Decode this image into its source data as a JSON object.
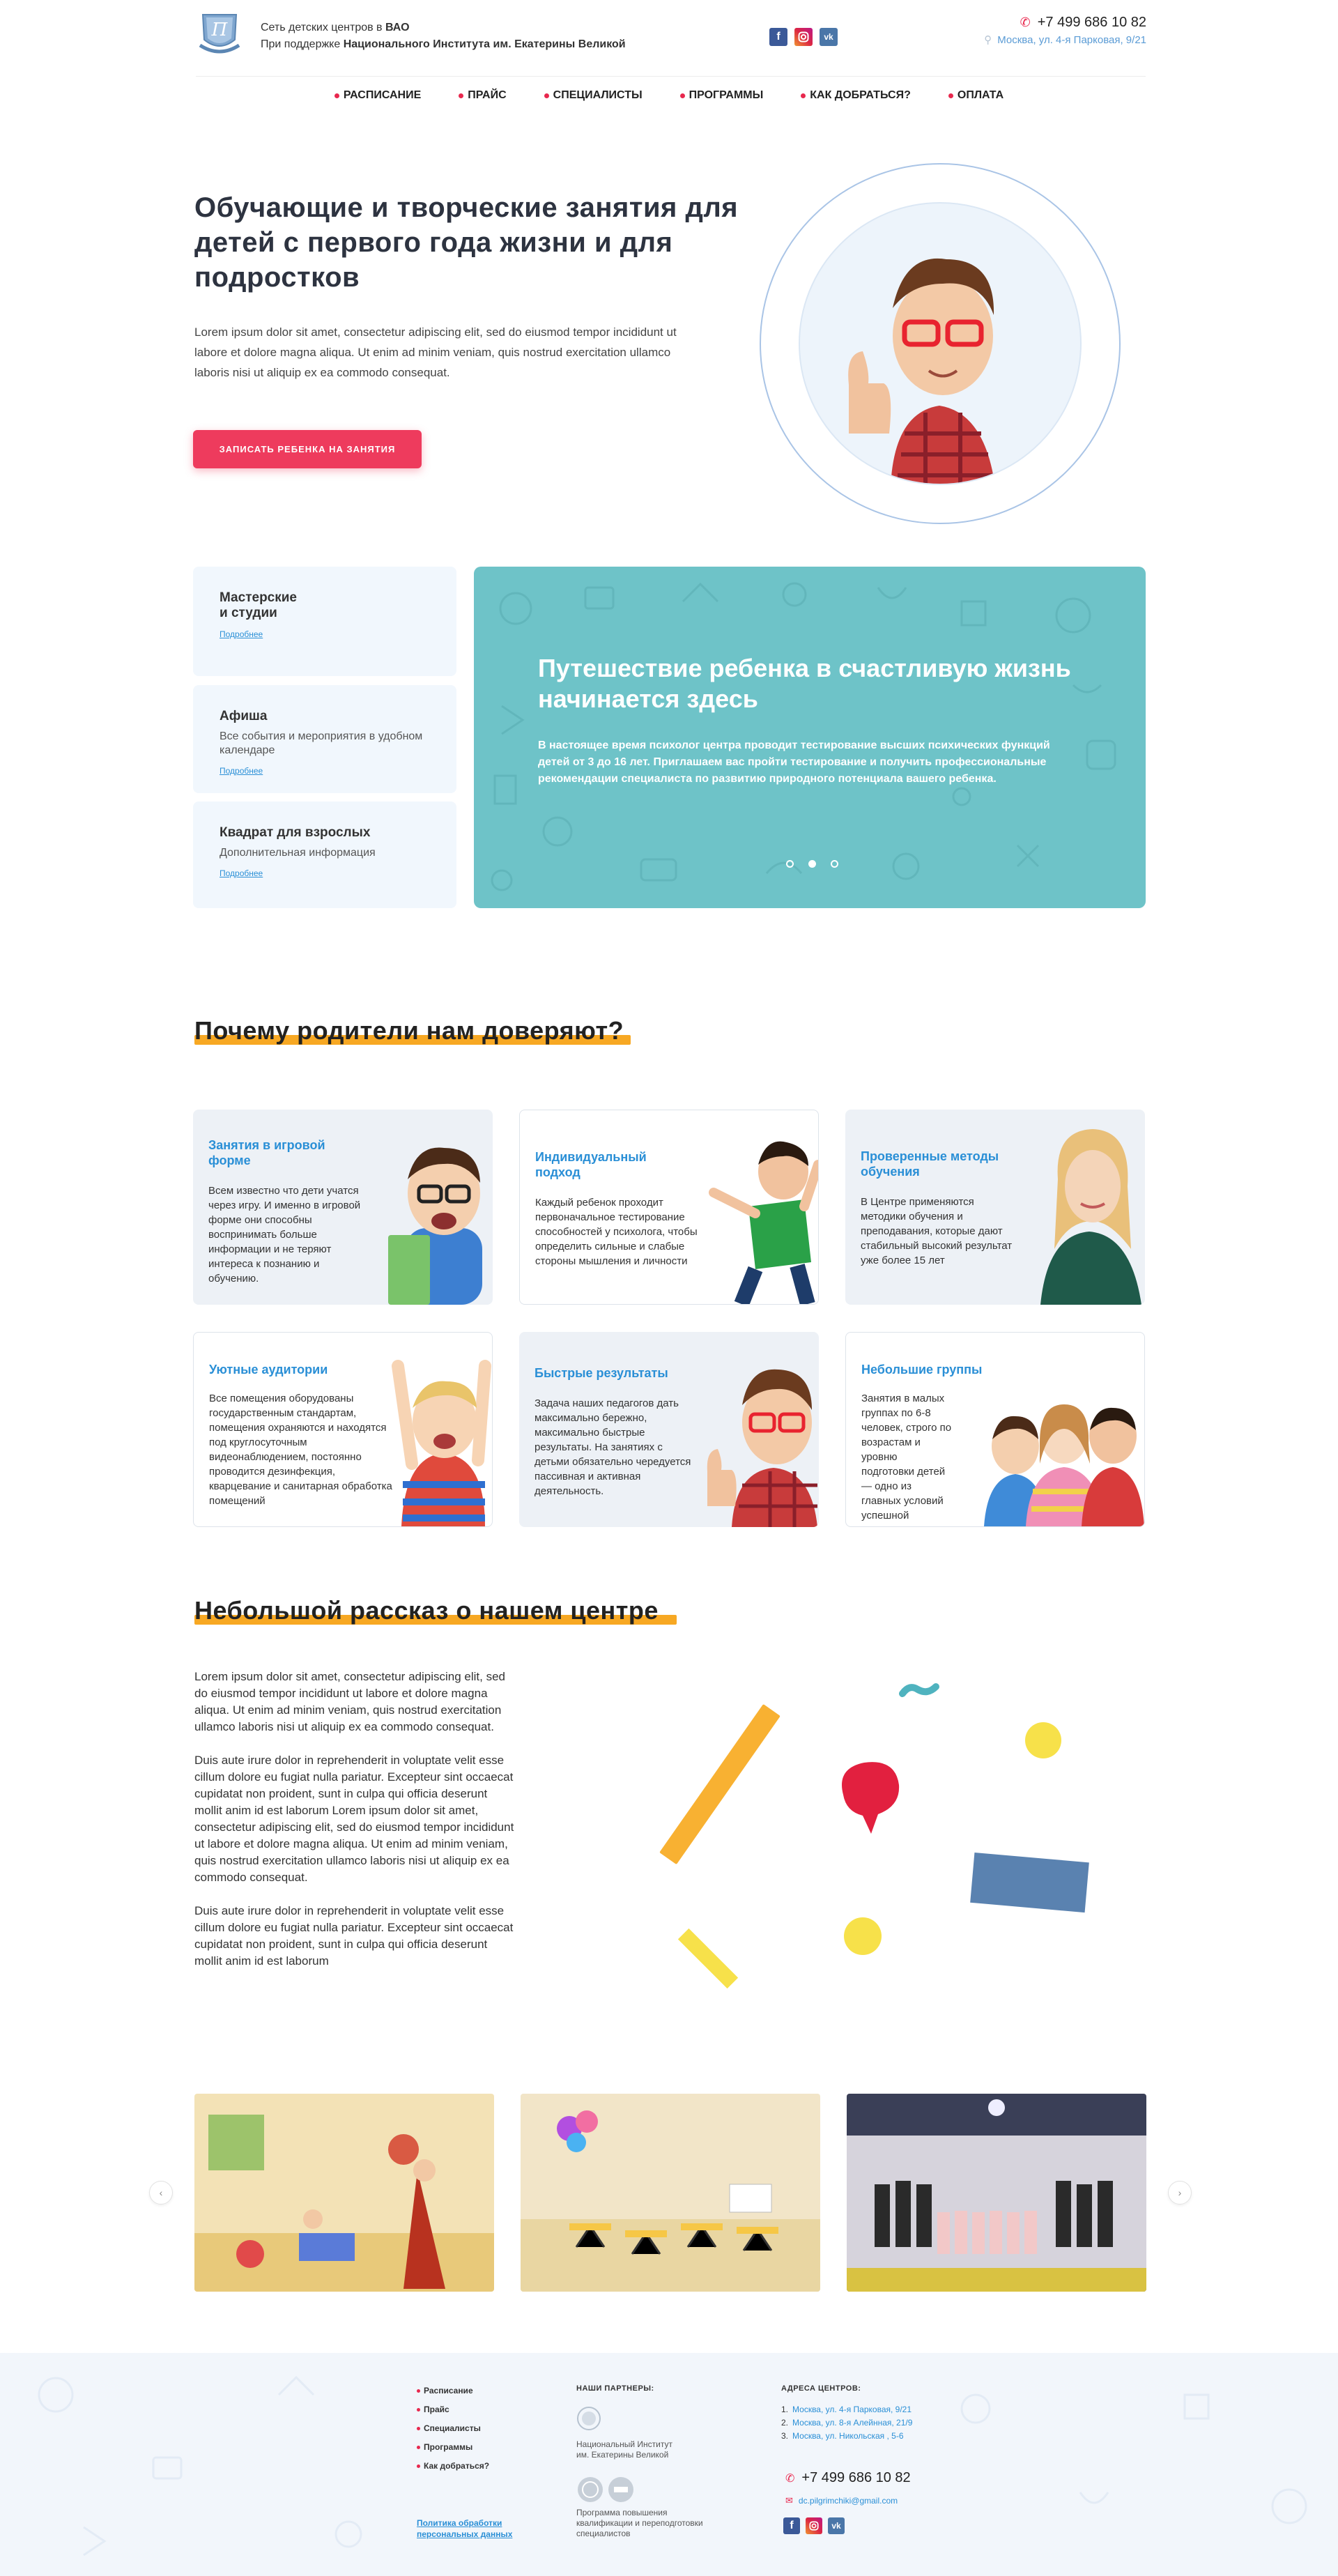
{
  "header": {
    "tagline_prefix": "Сеть детских центров в",
    "tagline_region": "ВАО",
    "support_prefix": "При поддержке",
    "support_org": "Национального Института им. Екатерины Великой",
    "phone": "+7 499 686 10 82",
    "address": "Москва, ул. 4-я Парковая, 9/21"
  },
  "nav": [
    "Расписание",
    "Прайс",
    "Специалисты",
    "Программы",
    "Как добраться?",
    "Оплата"
  ],
  "hero": {
    "title": "Обучающие и творческие занятия для детей с первого года жизни и для подростков",
    "description": "Lorem ipsum dolor sit amet, consectetur adipiscing elit, sed do eiusmod tempor incididunt ut labore et dolore magna aliqua. Ut enim ad minim veniam, quis nostrud exercitation ullamco laboris nisi ut aliquip ex ea commodo consequat.",
    "cta": "Записать ребенка на занятия"
  },
  "side_cards": [
    {
      "title": "Мастерские\nи студии",
      "text": "",
      "link": "Подробнее"
    },
    {
      "title": "Афиша",
      "text": "Все события и мероприятия в удобном календаре",
      "link": "Подробнее"
    },
    {
      "title": "Квадрат для взрослых",
      "text": "Дополнительная информация",
      "link": "Подробнее"
    }
  ],
  "banner": {
    "title": "Путешествие ребенка в счастливую жизнь начинается здесь",
    "text": "В настоящее время психолог центра проводит тестирование высших психических функций детей от 3 до 16 лет. Приглашаем вас пройти тестирование и получить профессиональные рекомендации специалиста по развитию природного потенциала вашего ребенка.",
    "active_slide": 2
  },
  "trust": {
    "title": "Почему родители нам доверяют?",
    "cards": [
      {
        "title": "Занятия в игровой\nформе",
        "text": "Всем известно что дети учатся через игру. И именно в игровой форме они способны воспринимать больше информации и не теряют интереса к познанию и обучению."
      },
      {
        "title": "Индивидуальный\nподход",
        "text": "Каждый ребенок проходит первоначальное тестирование способностей у психолога, чтобы определить сильные и слабые стороны мышления и личности"
      },
      {
        "title": "Проверенные методы\nобучения",
        "text": "В Центре применяются методики обучения и преподавания, которые дают стабильный высокий результат уже более 15 лет"
      },
      {
        "title": "Уютные аудитории",
        "text": "Все помещения оборудованы государственным стандартам, помещения охраняются и находятся под круглосуточным видеонаблюдением, постоянно проводится дезинфекция, кварцевание и санитарная обработка помещений"
      },
      {
        "title": "Быстрые результаты",
        "text": "Задача наших педагогов дать максимально бережно, максимально быстрые результаты. На занятиях с детьми обязательно чередуется пассивная и активная деятельность."
      },
      {
        "title": "Небольшие группы",
        "text": "Занятия в малых группах по 6-8 человек, строго по возрастам и уровню подготовки детей — одно из главных условий успешной социализации"
      }
    ]
  },
  "story": {
    "title": "Небольшой рассказ о нашем центре",
    "paragraphs": [
      "Lorem ipsum dolor sit amet, consectetur adipiscing elit, sed do eiusmod tempor incididunt ut labore et dolore magna aliqua. Ut enim ad minim veniam, quis nostrud exercitation ullamco laboris nisi ut aliquip ex ea commodo consequat.",
      "Duis aute irure dolor in reprehenderit in voluptate velit esse cillum dolore eu fugiat nulla pariatur. Excepteur sint occaecat cupidatat non proident, sunt in culpa qui officia deserunt mollit anim id est laborum Lorem ipsum dolor sit amet, consectetur adipiscing elit, sed do eiusmod tempor incididunt ut labore et dolore magna aliqua. Ut enim ad minim veniam, quis nostrud exercitation ullamco laboris nisi ut aliquip ex ea commodo consequat.",
      "Duis aute irure dolor in reprehenderit in voluptate velit esse cillum dolore eu fugiat nulla pariatur. Excepteur sint occaecat cupidatat non proident, sunt in culpa qui officia deserunt mollit anim id est laborum"
    ]
  },
  "gallery": {
    "prev": "‹",
    "next": "›"
  },
  "footer": {
    "nav": [
      "Расписание",
      "Прайс",
      "Специалисты",
      "Программы",
      "Как добраться?"
    ],
    "policy": "Политика обработки\nперсональных данных",
    "partners_title": "Наши партнеры:",
    "partner1": "Национальный Институт\nим. Екатерины Великой",
    "partner2": "Программа повышения\nквалификации и переподготовки\nспециалистов",
    "addresses_title": "Адреса центров:",
    "addresses": [
      "Москва, ул. 4-я Парковая, 9/21",
      "Москва, ул. 8-я Алейнная, 21/9",
      "Москва, ул. Никольская , 5-6"
    ],
    "phone": "+7 499 686 10 82",
    "email": "dc.pilgrimchiki@gmail.com"
  },
  "colors": {
    "accent": "#ee3b5d",
    "link": "#2a8fd6",
    "highlight": "#f7a823",
    "banner": "#6ec3c8"
  }
}
